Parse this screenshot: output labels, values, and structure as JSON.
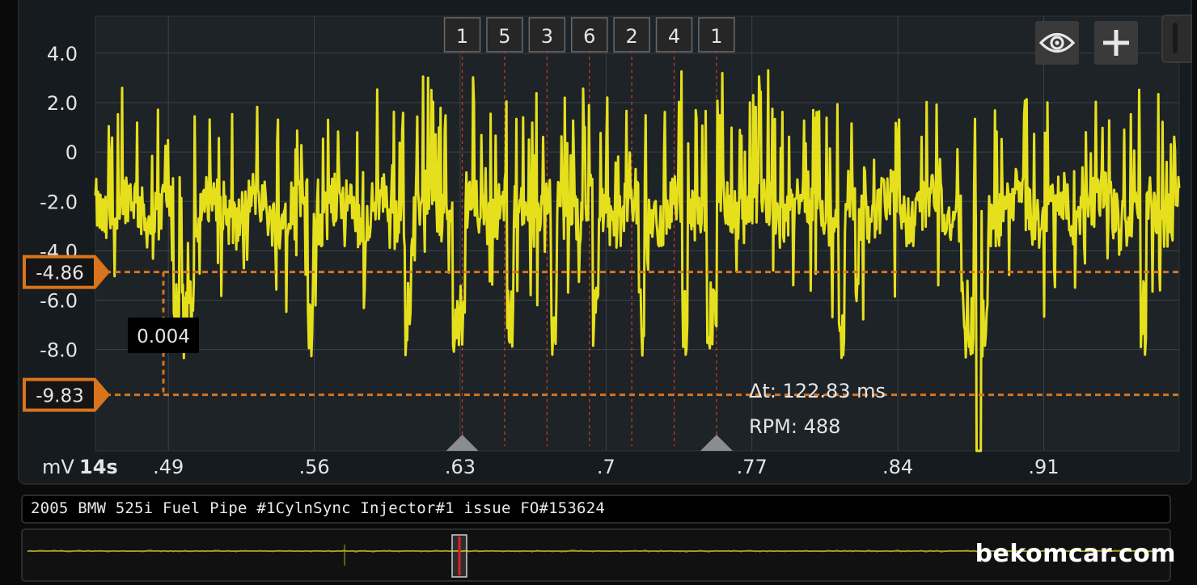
{
  "chart_data": {
    "type": "line",
    "x_unit_label": "14s",
    "y_unit_label": "mV",
    "xlim": [
      0.455,
      0.975
    ],
    "ylim": [
      -12.1,
      5.5
    ],
    "x_ticks": [
      ".49",
      ".56",
      ".63",
      ".7",
      ".77",
      ".84",
      ".91"
    ],
    "y_ticks": [
      "4.0",
      "2.0",
      "0",
      "-2.0",
      "-4.0",
      "-6.0",
      "-8.0"
    ],
    "series": [
      {
        "color": "#e6e01c",
        "description_hidden": true,
        "seed": 7
      }
    ],
    "cursor_levels": [
      {
        "label": "-4.86",
        "value": -4.86
      },
      {
        "label": "-9.83",
        "value": -9.83
      }
    ],
    "cursor_marker_label": "0.004",
    "delta_time_label": "Δt: 122.83 ms",
    "rpm_label": "RPM: 488",
    "firing_order": [
      "1",
      "5",
      "3",
      "6",
      "2",
      "4",
      "1"
    ],
    "cycle_start": 0.631,
    "cycle_end": 0.753,
    "spikes_negative": [
      0.494,
      0.498,
      0.501,
      0.558,
      0.605,
      0.628,
      0.631,
      0.654,
      0.675,
      0.695,
      0.717,
      0.738,
      0.75,
      0.752,
      0.813,
      0.872,
      0.875,
      0.882,
      0.958
    ],
    "big_spike": 0.879
  },
  "buttons": {
    "eye": "eye-icon",
    "plus": "plus-icon"
  },
  "description": "2005 BMW 525i Fuel Pipe #1CylnSync Injector#1 issue FO#153624",
  "watermark": "bekomcar.com",
  "colors": {
    "trace": "#e6e01c",
    "cursor": "#d9741d",
    "firing_line": "#d43a2a",
    "grid": "#3c4348"
  }
}
